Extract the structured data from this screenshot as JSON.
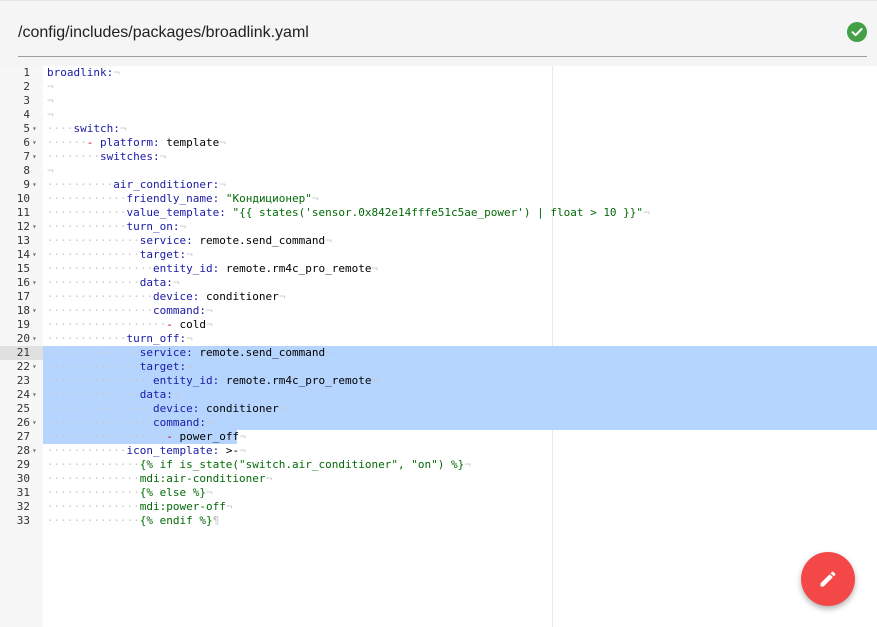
{
  "header": {
    "file_path": "/config/includes/packages/broadlink.yaml",
    "status_icon": "check-circle-icon",
    "status_color": "#43a047"
  },
  "editor": {
    "selection_color": "#b5d5ff",
    "lines": [
      {
        "n": "1",
        "fold": false,
        "indent": 0,
        "parts": [
          [
            "key",
            "broadlink:"
          ]
        ]
      },
      {
        "n": "2",
        "fold": false,
        "indent": 0,
        "parts": []
      },
      {
        "n": "3",
        "fold": false,
        "indent": 0,
        "parts": []
      },
      {
        "n": "4",
        "fold": false,
        "indent": 0,
        "parts": []
      },
      {
        "n": "5",
        "fold": true,
        "indent": 4,
        "parts": [
          [
            "key",
            "switch:"
          ]
        ]
      },
      {
        "n": "6",
        "fold": true,
        "indent": 6,
        "parts": [
          [
            "dash",
            "- "
          ],
          [
            "key",
            "platform:"
          ],
          [
            "val",
            " template"
          ]
        ]
      },
      {
        "n": "7",
        "fold": true,
        "indent": 8,
        "parts": [
          [
            "key",
            "switches:"
          ]
        ]
      },
      {
        "n": "8",
        "fold": false,
        "indent": 0,
        "parts": []
      },
      {
        "n": "9",
        "fold": true,
        "indent": 10,
        "parts": [
          [
            "key",
            "air_conditioner:"
          ]
        ]
      },
      {
        "n": "10",
        "fold": false,
        "indent": 12,
        "parts": [
          [
            "key",
            "friendly_name:"
          ],
          [
            "str",
            " \"Кондиционер\""
          ]
        ]
      },
      {
        "n": "11",
        "fold": false,
        "indent": 12,
        "parts": [
          [
            "key",
            "value_template:"
          ],
          [
            "str",
            " \"{{ states('sensor.0x842e14fffe51c5ae_power') | float > 10 }}\""
          ]
        ]
      },
      {
        "n": "12",
        "fold": true,
        "indent": 12,
        "parts": [
          [
            "key",
            "turn_on:"
          ]
        ]
      },
      {
        "n": "13",
        "fold": false,
        "indent": 14,
        "parts": [
          [
            "key",
            "service:"
          ],
          [
            "val",
            " remote.send_command"
          ]
        ]
      },
      {
        "n": "14",
        "fold": true,
        "indent": 14,
        "parts": [
          [
            "key",
            "target:"
          ]
        ]
      },
      {
        "n": "15",
        "fold": false,
        "indent": 16,
        "parts": [
          [
            "key",
            "entity_id:"
          ],
          [
            "val",
            " remote.rm4c_pro_remote"
          ]
        ]
      },
      {
        "n": "16",
        "fold": true,
        "indent": 14,
        "parts": [
          [
            "key",
            "data:"
          ]
        ]
      },
      {
        "n": "17",
        "fold": false,
        "indent": 16,
        "parts": [
          [
            "key",
            "device:"
          ],
          [
            "val",
            " conditioner"
          ]
        ]
      },
      {
        "n": "18",
        "fold": true,
        "indent": 16,
        "parts": [
          [
            "key",
            "command:"
          ]
        ]
      },
      {
        "n": "19",
        "fold": false,
        "indent": 18,
        "parts": [
          [
            "dash",
            "- "
          ],
          [
            "val",
            "cold"
          ]
        ]
      },
      {
        "n": "20",
        "fold": true,
        "indent": 12,
        "parts": [
          [
            "key",
            "turn_off:"
          ]
        ]
      },
      {
        "n": "21",
        "fold": false,
        "indent": 14,
        "parts": [
          [
            "key",
            "service:"
          ],
          [
            "val",
            " remote.send_command"
          ]
        ],
        "sel": true,
        "active": true
      },
      {
        "n": "22",
        "fold": true,
        "indent": 14,
        "parts": [
          [
            "key",
            "target:"
          ]
        ],
        "sel": true
      },
      {
        "n": "23",
        "fold": false,
        "indent": 16,
        "parts": [
          [
            "key",
            "entity_id:"
          ],
          [
            "val",
            " remote.rm4c_pro_remote"
          ]
        ],
        "sel": true
      },
      {
        "n": "24",
        "fold": true,
        "indent": 14,
        "parts": [
          [
            "key",
            "data:"
          ]
        ],
        "sel": true
      },
      {
        "n": "25",
        "fold": false,
        "indent": 16,
        "parts": [
          [
            "key",
            "device:"
          ],
          [
            "val",
            " conditioner"
          ]
        ],
        "sel": true
      },
      {
        "n": "26",
        "fold": true,
        "indent": 16,
        "parts": [
          [
            "key",
            "command:"
          ]
        ],
        "sel": true
      },
      {
        "n": "27",
        "fold": false,
        "indent": 18,
        "parts": [
          [
            "dash",
            "- "
          ],
          [
            "val",
            "power_off"
          ]
        ],
        "sel": true,
        "partial": true
      },
      {
        "n": "28",
        "fold": true,
        "indent": 12,
        "parts": [
          [
            "key",
            "icon_template:"
          ],
          [
            "val",
            " >-"
          ]
        ]
      },
      {
        "n": "29",
        "fold": false,
        "indent": 14,
        "parts": [
          [
            "tpl",
            "{% if is_state(\"switch.air_conditioner\", \"on\") %}"
          ]
        ]
      },
      {
        "n": "30",
        "fold": false,
        "indent": 14,
        "parts": [
          [
            "tpl",
            "mdi:air-conditioner"
          ]
        ]
      },
      {
        "n": "31",
        "fold": false,
        "indent": 14,
        "parts": [
          [
            "tpl",
            "{% else %}"
          ]
        ]
      },
      {
        "n": "32",
        "fold": false,
        "indent": 14,
        "parts": [
          [
            "tpl",
            "mdi:power-off"
          ]
        ]
      },
      {
        "n": "33",
        "fold": false,
        "indent": 14,
        "parts": [
          [
            "tpl",
            "{% endif %}"
          ]
        ],
        "last": true
      }
    ]
  },
  "fab": {
    "icon": "pencil-icon",
    "color": "#f44848"
  }
}
